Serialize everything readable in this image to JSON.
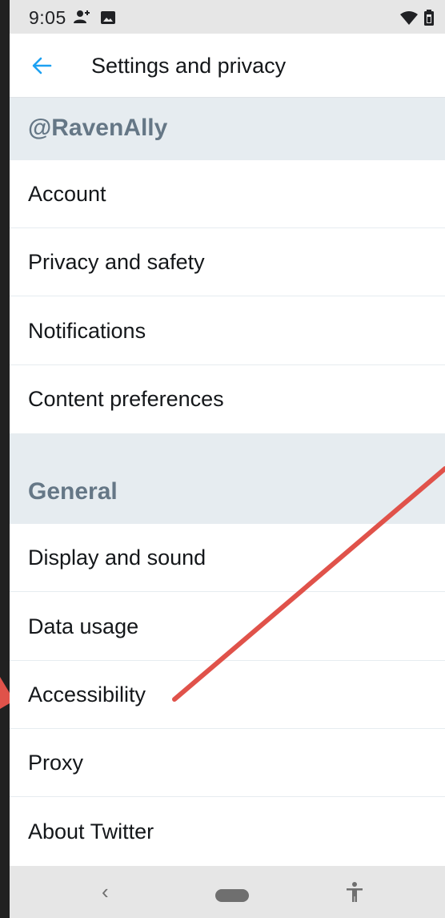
{
  "status_bar": {
    "time": "9:05",
    "icons": [
      "person-add-icon",
      "image-icon",
      "wifi-icon",
      "battery-icon"
    ]
  },
  "app_bar": {
    "back_icon": "arrow-left-icon",
    "title": "Settings and privacy"
  },
  "account_section": {
    "header": "@RavenAlly",
    "items": [
      {
        "label": "Account"
      },
      {
        "label": "Privacy and safety"
      },
      {
        "label": "Notifications"
      },
      {
        "label": "Content preferences"
      }
    ]
  },
  "general_section": {
    "header": "General",
    "items": [
      {
        "label": "Display and sound"
      },
      {
        "label": "Data usage"
      },
      {
        "label": "Accessibility"
      },
      {
        "label": "Proxy"
      },
      {
        "label": "About Twitter"
      }
    ]
  },
  "nav_bar": {
    "back_glyph": "‹",
    "icons": [
      "nav-back-icon",
      "home-pill-icon",
      "accessibility-icon"
    ]
  },
  "colors": {
    "accent": "#1da1f2",
    "section_bg": "#e6ecf0",
    "section_text": "#657786",
    "annotation": "#e0524a"
  }
}
